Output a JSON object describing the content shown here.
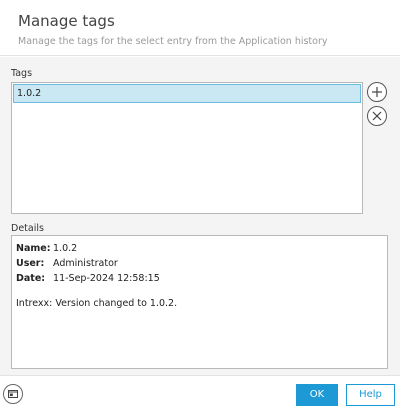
{
  "header": {
    "title": "Manage tags",
    "subtitle": "Manage the tags for the select entry from the Application history"
  },
  "tags": {
    "label": "Tags",
    "items": [
      "1.0.2"
    ],
    "selected_index": 0,
    "add_icon": "plus-icon",
    "remove_icon": "close-icon"
  },
  "details": {
    "label": "Details",
    "rows": [
      {
        "key": "Name:",
        "value": "1.0.2"
      },
      {
        "key": "User:",
        "value": "Administrator"
      },
      {
        "key": "Date:",
        "value": "11-Sep-2024 12:58:15"
      }
    ],
    "message": "Intrexx: Version changed to 1.0.2."
  },
  "footer": {
    "left_icon": "window-icon",
    "ok_label": "OK",
    "help_label": "Help"
  },
  "colors": {
    "accent": "#1d9ad6",
    "selection_bg": "#c9e8f4",
    "selection_border": "#6bbde0"
  }
}
